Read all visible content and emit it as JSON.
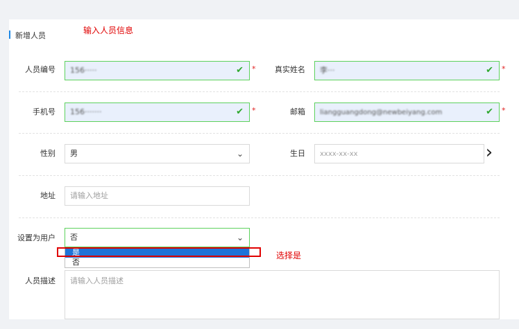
{
  "section": {
    "title": "新增人员"
  },
  "annotations": {
    "top": "输入人员信息",
    "select": "选择是"
  },
  "fields": {
    "person_no": {
      "label": "人员编号",
      "value": "156·····"
    },
    "real_name": {
      "label": "真实姓名",
      "value": "李···"
    },
    "phone": {
      "label": "手机号",
      "value": "156·······"
    },
    "email": {
      "label": "邮箱",
      "value": "liangguangdong@newbeiyang.com"
    },
    "gender": {
      "label": "性别",
      "value": "男"
    },
    "birthday": {
      "label": "生日",
      "placeholder": "xxxx-xx-xx"
    },
    "address": {
      "label": "地址",
      "placeholder": "请输入地址"
    },
    "set_user": {
      "label": "设置为用户",
      "value": "否",
      "options": [
        "是",
        "否"
      ]
    },
    "description": {
      "label": "人员描述",
      "placeholder": "请输入人员描述"
    }
  },
  "required_mark": "*",
  "icons": {
    "check": "✔",
    "chevron": "⌄",
    "arrow": "›"
  },
  "colors": {
    "accent": "#1e88e5",
    "valid_border": "#5cd15c",
    "valid_bg": "#e9f0fc",
    "annotation": "#e00000",
    "selected_option": "#1e73d8"
  }
}
